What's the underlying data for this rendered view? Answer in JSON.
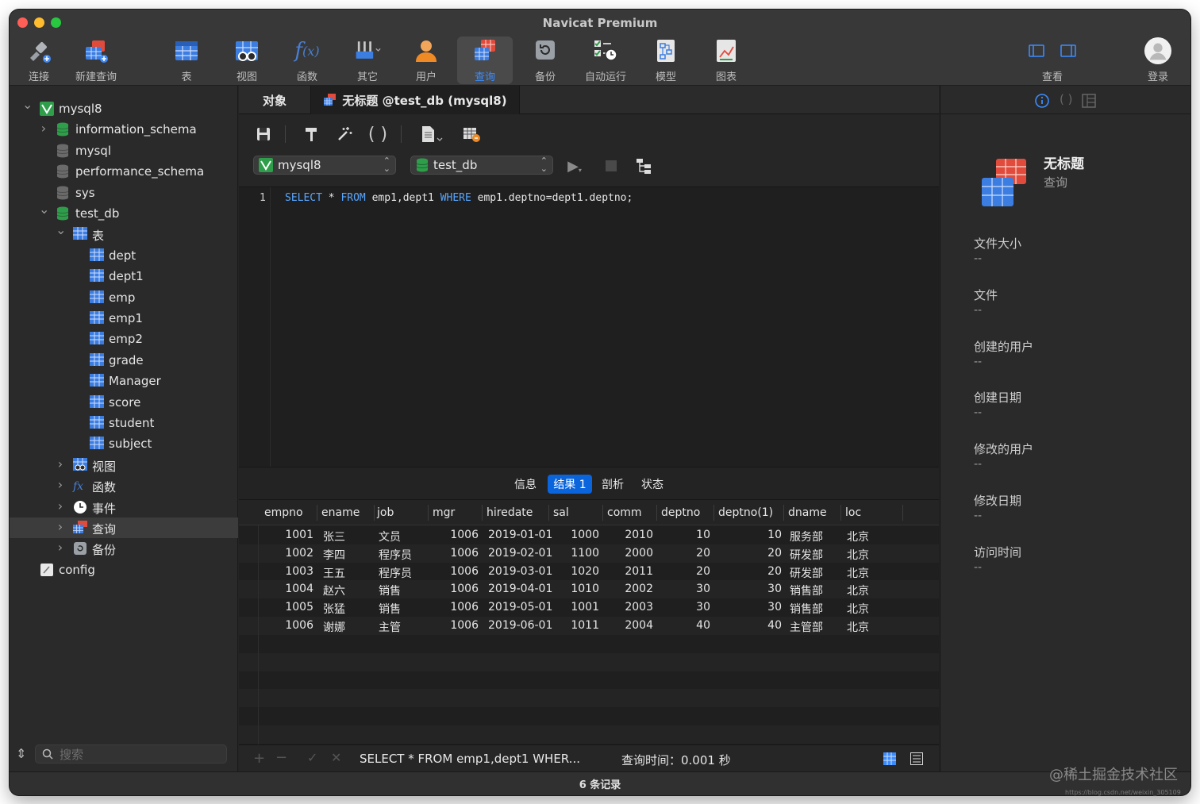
{
  "window": {
    "title": "Navicat Premium"
  },
  "toolbar": {
    "items": [
      {
        "label": "连接",
        "icon": "connect-icon"
      },
      {
        "label": "新建查询",
        "icon": "new-query-icon"
      },
      {
        "label": "表",
        "icon": "table-icon"
      },
      {
        "label": "视图",
        "icon": "view-icon"
      },
      {
        "label": "函数",
        "icon": "function-icon"
      },
      {
        "label": "其它",
        "icon": "other-icon"
      },
      {
        "label": "用户",
        "icon": "user-icon"
      },
      {
        "label": "查询",
        "icon": "query-icon",
        "active": true
      },
      {
        "label": "备份",
        "icon": "backup-icon"
      },
      {
        "label": "自动运行",
        "icon": "automation-icon"
      },
      {
        "label": "模型",
        "icon": "model-icon"
      },
      {
        "label": "图表",
        "icon": "chart-icon"
      }
    ],
    "view_label": "查看",
    "login_label": "登录"
  },
  "sidebar": {
    "tree": [
      {
        "label": "mysql8",
        "icon": "mysql-connection-icon",
        "expanded": true
      },
      {
        "label": "information_schema",
        "icon": "database-icon"
      },
      {
        "label": "mysql",
        "icon": "database-icon"
      },
      {
        "label": "performance_schema",
        "icon": "database-icon"
      },
      {
        "label": "sys",
        "icon": "database-icon"
      },
      {
        "label": "test_db",
        "icon": "database-icon",
        "expanded": true
      },
      {
        "label": "表",
        "icon": "table-group-icon",
        "expanded": true
      },
      {
        "label": "dept",
        "icon": "table-icon"
      },
      {
        "label": "dept1",
        "icon": "table-icon"
      },
      {
        "label": "emp",
        "icon": "table-icon"
      },
      {
        "label": "emp1",
        "icon": "table-icon"
      },
      {
        "label": "emp2",
        "icon": "table-icon"
      },
      {
        "label": "grade",
        "icon": "table-icon"
      },
      {
        "label": "Manager",
        "icon": "table-icon"
      },
      {
        "label": "score",
        "icon": "table-icon"
      },
      {
        "label": "student",
        "icon": "table-icon"
      },
      {
        "label": "subject",
        "icon": "table-icon"
      },
      {
        "label": "视图",
        "icon": "view-icon"
      },
      {
        "label": "函数",
        "icon": "function-icon"
      },
      {
        "label": "事件",
        "icon": "event-icon"
      },
      {
        "label": "查询",
        "icon": "query-icon",
        "selected": true
      },
      {
        "label": "备份",
        "icon": "backup-icon"
      },
      {
        "label": "config",
        "icon": "config-icon"
      }
    ],
    "search_placeholder": "搜索"
  },
  "tabs": {
    "objects": "对象",
    "query": "无标题 @test_db (mysql8)"
  },
  "query_toolbar": {
    "connection": "mysql8",
    "database": "test_db"
  },
  "editor": {
    "line_number": "1",
    "kw_select": "SELECT",
    "part_star": " * ",
    "kw_from": "FROM",
    "part_tables": " emp1,dept1 ",
    "kw_where": "WHERE",
    "part_cond": " emp1.deptno=dept1.deptno;"
  },
  "result_tabs": [
    "信息",
    "结果 1",
    "剖析",
    "状态"
  ],
  "grid": {
    "columns": [
      "empno",
      "ename",
      "job",
      "mgr",
      "hiredate",
      "sal",
      "comm",
      "deptno",
      "deptno(1)",
      "dname",
      "loc"
    ],
    "rows": [
      [
        "1001",
        "张三",
        "文员",
        "1006",
        "2019-01-01",
        "1000",
        "2010",
        "10",
        "10",
        "服务部",
        "北京"
      ],
      [
        "1002",
        "李四",
        "程序员",
        "1006",
        "2019-02-01",
        "1100",
        "2000",
        "20",
        "20",
        "研发部",
        "北京"
      ],
      [
        "1003",
        "王五",
        "程序员",
        "1006",
        "2019-03-01",
        "1020",
        "2011",
        "20",
        "20",
        "研发部",
        "北京"
      ],
      [
        "1004",
        "赵六",
        "销售",
        "1006",
        "2019-04-01",
        "1010",
        "2002",
        "30",
        "30",
        "销售部",
        "北京"
      ],
      [
        "1005",
        "张猛",
        "销售",
        "1006",
        "2019-05-01",
        "1001",
        "2003",
        "30",
        "30",
        "销售部",
        "北京"
      ],
      [
        "1006",
        "谢娜",
        "主管",
        "1006",
        "2019-06-01",
        "1011",
        "2004",
        "40",
        "40",
        "主管部",
        "北京"
      ]
    ]
  },
  "bottom_bar": {
    "sql_preview": "SELECT * FROM emp1,dept1 WHER...",
    "query_time": "查询时间：0.001 秒"
  },
  "footer": {
    "record_count": "6 条记录"
  },
  "info_panel": {
    "title": "无标题",
    "subtitle": "查询",
    "fields": [
      {
        "label": "文件大小",
        "value": "--"
      },
      {
        "label": "文件",
        "value": "--"
      },
      {
        "label": "创建的用户",
        "value": "--"
      },
      {
        "label": "创建日期",
        "value": "--"
      },
      {
        "label": "修改的用户",
        "value": "--"
      },
      {
        "label": "修改日期",
        "value": "--"
      },
      {
        "label": "访问时间",
        "value": "--"
      }
    ]
  },
  "watermark": "@稀土掘金技术社区",
  "watermark_url": "https://blog.csdn.net/weixin_305109",
  "colors": {
    "accent": "#0a64dc",
    "keyword": "#58a6ff",
    "background": "#1f1f1f"
  }
}
